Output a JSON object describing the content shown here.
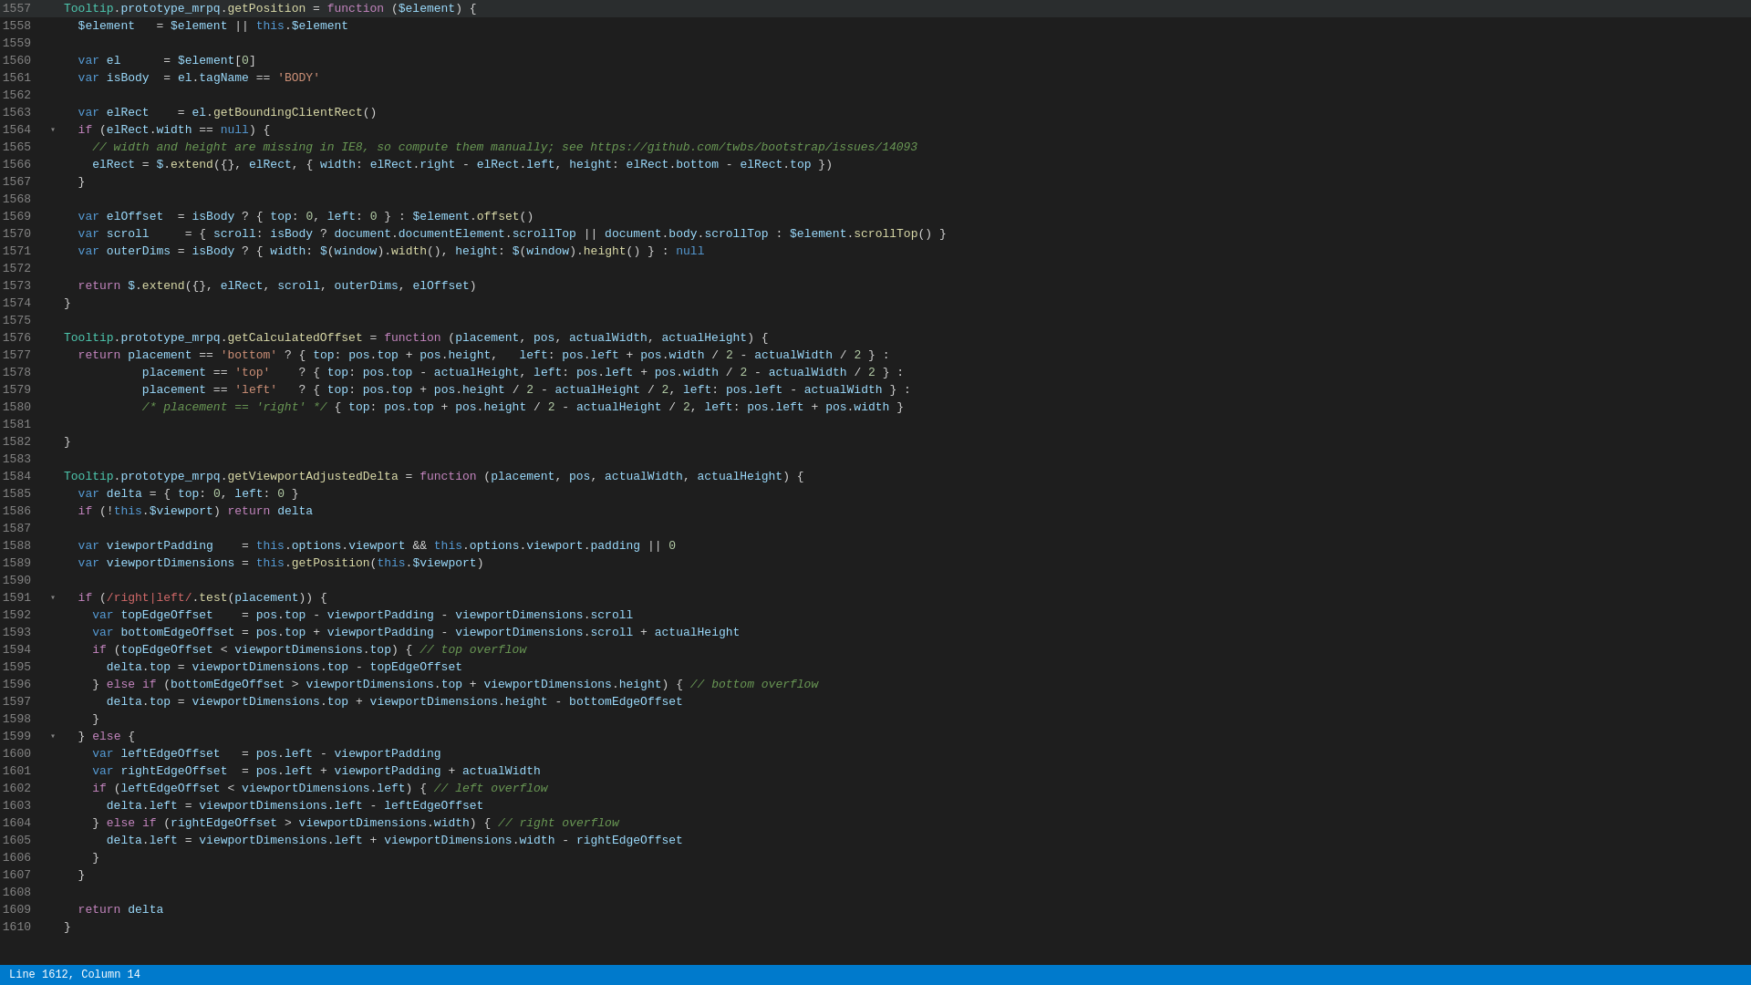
{
  "status_bar": {
    "line_col": "Line 1612, Column 14"
  },
  "lines": [
    {
      "num": 1557,
      "fold": "",
      "content": "<span class='cls'>Tooltip</span><span class='op'>.</span><span class='prop'>prototype_mrpq</span><span class='op'>.</span><span class='fn'>getPosition</span> <span class='op'>=</span> <span class='kw'>function</span> <span class='punc'>(</span><span class='param'>$element</span><span class='punc'>) {</span>"
    },
    {
      "num": 1558,
      "fold": "",
      "content": "  <span class='param'>$element</span>   <span class='op'>=</span> <span class='param'>$element</span> <span class='op'>||</span> <span class='this'>this</span><span class='op'>.</span><span class='prop'>$element</span>"
    },
    {
      "num": 1559,
      "fold": "",
      "content": ""
    },
    {
      "num": 1560,
      "fold": "",
      "content": "  <span class='kw2'>var</span> <span class='prop'>el</span>      <span class='op'>=</span> <span class='param'>$element</span><span class='punc'>[</span><span class='num'>0</span><span class='punc'>]</span>"
    },
    {
      "num": 1561,
      "fold": "",
      "content": "  <span class='kw2'>var</span> <span class='prop'>isBody</span>  <span class='op'>=</span> <span class='prop'>el</span><span class='op'>.</span><span class='prop'>tagName</span> <span class='op'>==</span> <span class='str'>'BODY'</span>"
    },
    {
      "num": 1562,
      "fold": "",
      "content": ""
    },
    {
      "num": 1563,
      "fold": "",
      "content": "  <span class='kw2'>var</span> <span class='prop'>elRect</span>    <span class='op'>=</span> <span class='prop'>el</span><span class='op'>.</span><span class='fn'>getBoundingClientRect</span><span class='punc'>()</span>"
    },
    {
      "num": 1564,
      "fold": "open",
      "content": "  <span class='kw'>if</span> <span class='punc'>(</span><span class='prop'>elRect</span><span class='op'>.</span><span class='prop'>width</span> <span class='op'>==</span> <span class='bool'>null</span><span class='punc'>) {</span>"
    },
    {
      "num": 1565,
      "fold": "",
      "content": "    <span class='cmt'>// width and height are missing in IE8, so compute them manually; see https://github.com/twbs/bootstrap/issues/14093</span>"
    },
    {
      "num": 1566,
      "fold": "",
      "content": "    <span class='prop'>elRect</span> <span class='op'>=</span> <span class='prop'>$</span><span class='op'>.</span><span class='fn'>extend</span><span class='punc'>(</span><span class='punc'>{},</span> <span class='prop'>elRect</span><span class='punc'>,</span> <span class='punc'>{ </span><span class='prop'>width</span><span class='op'>:</span> <span class='prop'>elRect</span><span class='op'>.</span><span class='prop'>right</span> <span class='op'>-</span> <span class='prop'>elRect</span><span class='op'>.</span><span class='prop'>left</span><span class='punc'>,</span> <span class='prop'>height</span><span class='op'>:</span> <span class='prop'>elRect</span><span class='op'>.</span><span class='prop'>bottom</span> <span class='op'>-</span> <span class='prop'>elRect</span><span class='op'>.</span><span class='prop'>top</span> <span class='punc'>})</span>"
    },
    {
      "num": 1567,
      "fold": "",
      "content": "  <span class='punc'>}</span>"
    },
    {
      "num": 1568,
      "fold": "",
      "content": ""
    },
    {
      "num": 1569,
      "fold": "",
      "content": "  <span class='kw2'>var</span> <span class='prop'>elOffset</span>  <span class='op'>=</span> <span class='prop'>isBody</span> <span class='op'>?</span> <span class='punc'>{ </span><span class='prop'>top</span><span class='op'>:</span> <span class='num'>0</span><span class='punc'>,</span> <span class='prop'>left</span><span class='op'>:</span> <span class='num'>0</span> <span class='punc'>}</span> <span class='op'>:</span> <span class='param'>$element</span><span class='op'>.</span><span class='fn'>offset</span><span class='punc'>()</span>"
    },
    {
      "num": 1570,
      "fold": "",
      "content": "  <span class='kw2'>var</span> <span class='prop'>scroll</span>     <span class='op'>=</span> <span class='punc'>{ </span><span class='prop'>scroll</span><span class='op'>:</span> <span class='prop'>isBody</span> <span class='op'>?</span> <span class='prop'>document</span><span class='op'>.</span><span class='prop'>documentElement</span><span class='op'>.</span><span class='prop'>scrollTop</span> <span class='op'>||</span> <span class='prop'>document</span><span class='op'>.</span><span class='prop'>body</span><span class='op'>.</span><span class='prop'>scrollTop</span> <span class='op'>:</span> <span class='param'>$element</span><span class='op'>.</span><span class='fn'>scrollTop</span><span class='punc'>() }</span>"
    },
    {
      "num": 1571,
      "fold": "",
      "content": "  <span class='kw2'>var</span> <span class='prop'>outerDims</span> <span class='op'>=</span> <span class='prop'>isBody</span> <span class='op'>?</span> <span class='punc'>{ </span><span class='prop'>width</span><span class='op'>:</span> <span class='prop'>$</span><span class='punc'>(</span><span class='prop'>window</span><span class='punc'>)</span><span class='op'>.</span><span class='fn'>width</span><span class='punc'>(),</span> <span class='prop'>height</span><span class='op'>:</span> <span class='prop'>$</span><span class='punc'>(</span><span class='prop'>window</span><span class='punc'>)</span><span class='op'>.</span><span class='fn'>height</span><span class='punc'>() }</span> <span class='op'>:</span> <span class='bool'>null</span>"
    },
    {
      "num": 1572,
      "fold": "",
      "content": ""
    },
    {
      "num": 1573,
      "fold": "",
      "content": "  <span class='kw'>return</span> <span class='prop'>$</span><span class='op'>.</span><span class='fn'>extend</span><span class='punc'>(</span><span class='punc'>{},</span> <span class='prop'>elRect</span><span class='punc'>,</span> <span class='prop'>scroll</span><span class='punc'>,</span> <span class='prop'>outerDims</span><span class='punc'>,</span> <span class='prop'>elOffset</span><span class='punc'>)</span>"
    },
    {
      "num": 1574,
      "fold": "",
      "content": "<span class='punc'>}</span>"
    },
    {
      "num": 1575,
      "fold": "",
      "content": ""
    },
    {
      "num": 1576,
      "fold": "",
      "content": "<span class='cls'>Tooltip</span><span class='op'>.</span><span class='prop'>prototype_mrpq</span><span class='op'>.</span><span class='fn'>getCalculatedOffset</span> <span class='op'>=</span> <span class='kw'>function</span> <span class='punc'>(</span><span class='param'>placement</span><span class='punc'>,</span> <span class='param'>pos</span><span class='punc'>,</span> <span class='param'>actualWidth</span><span class='punc'>,</span> <span class='param'>actualHeight</span><span class='punc'>) {</span>"
    },
    {
      "num": 1577,
      "fold": "",
      "content": "  <span class='kw'>return</span> <span class='param'>placement</span> <span class='op'>==</span> <span class='str'>'bottom'</span> <span class='op'>?</span> <span class='punc'>{ </span><span class='prop'>top</span><span class='op'>:</span> <span class='param'>pos</span><span class='op'>.</span><span class='prop'>top</span> <span class='op'>+</span> <span class='param'>pos</span><span class='op'>.</span><span class='prop'>height</span><span class='punc'>,</span>   <span class='prop'>left</span><span class='op'>:</span> <span class='param'>pos</span><span class='op'>.</span><span class='prop'>left</span> <span class='op'>+</span> <span class='param'>pos</span><span class='op'>.</span><span class='prop'>width</span> <span class='op'>/</span> <span class='num'>2</span> <span class='op'>-</span> <span class='param'>actualWidth</span> <span class='op'>/</span> <span class='num'>2</span> <span class='punc'>}</span> <span class='op'>:</span>"
    },
    {
      "num": 1578,
      "fold": "",
      "content": "           <span class='param'>placement</span> <span class='op'>==</span> <span class='str'>'top'</span>    <span class='op'>?</span> <span class='punc'>{ </span><span class='prop'>top</span><span class='op'>:</span> <span class='param'>pos</span><span class='op'>.</span><span class='prop'>top</span> <span class='op'>-</span> <span class='param'>actualHeight</span><span class='punc'>,</span> <span class='prop'>left</span><span class='op'>:</span> <span class='param'>pos</span><span class='op'>.</span><span class='prop'>left</span> <span class='op'>+</span> <span class='param'>pos</span><span class='op'>.</span><span class='prop'>width</span> <span class='op'>/</span> <span class='num'>2</span> <span class='op'>-</span> <span class='param'>actualWidth</span> <span class='op'>/</span> <span class='num'>2</span> <span class='punc'>}</span> <span class='op'>:</span>"
    },
    {
      "num": 1579,
      "fold": "",
      "content": "           <span class='param'>placement</span> <span class='op'>==</span> <span class='str'>'left'</span>   <span class='op'>?</span> <span class='punc'>{ </span><span class='prop'>top</span><span class='op'>:</span> <span class='param'>pos</span><span class='op'>.</span><span class='prop'>top</span> <span class='op'>+</span> <span class='param'>pos</span><span class='op'>.</span><span class='prop'>height</span> <span class='op'>/</span> <span class='num'>2</span> <span class='op'>-</span> <span class='param'>actualHeight</span> <span class='op'>/</span> <span class='num'>2</span><span class='punc'>,</span> <span class='prop'>left</span><span class='op'>:</span> <span class='param'>pos</span><span class='op'>.</span><span class='prop'>left</span> <span class='op'>-</span> <span class='param'>actualWidth</span> <span class='punc'>}</span> <span class='op'>:</span>"
    },
    {
      "num": 1580,
      "fold": "",
      "content": "           <span class='cmt'>/* placement == 'right' */</span> <span class='punc'>{ </span><span class='prop'>top</span><span class='op'>:</span> <span class='param'>pos</span><span class='op'>.</span><span class='prop'>top</span> <span class='op'>+</span> <span class='param'>pos</span><span class='op'>.</span><span class='prop'>height</span> <span class='op'>/</span> <span class='num'>2</span> <span class='op'>-</span> <span class='param'>actualHeight</span> <span class='op'>/</span> <span class='num'>2</span><span class='punc'>,</span> <span class='prop'>left</span><span class='op'>:</span> <span class='param'>pos</span><span class='op'>.</span><span class='prop'>left</span> <span class='op'>+</span> <span class='param'>pos</span><span class='op'>.</span><span class='prop'>width</span> <span class='punc'>}</span>"
    },
    {
      "num": 1581,
      "fold": "",
      "content": ""
    },
    {
      "num": 1582,
      "fold": "",
      "content": "<span class='punc'>}</span>"
    },
    {
      "num": 1583,
      "fold": "",
      "content": ""
    },
    {
      "num": 1584,
      "fold": "",
      "content": "<span class='cls'>Tooltip</span><span class='op'>.</span><span class='prop'>prototype_mrpq</span><span class='op'>.</span><span class='fn'>getViewportAdjustedDelta</span> <span class='op'>=</span> <span class='kw'>function</span> <span class='punc'>(</span><span class='param'>placement</span><span class='punc'>,</span> <span class='param'>pos</span><span class='punc'>,</span> <span class='param'>actualWidth</span><span class='punc'>,</span> <span class='param'>actualHeight</span><span class='punc'>) {</span>"
    },
    {
      "num": 1585,
      "fold": "",
      "content": "  <span class='kw2'>var</span> <span class='prop'>delta</span> <span class='op'>=</span> <span class='punc'>{ </span><span class='prop'>top</span><span class='op'>:</span> <span class='num'>0</span><span class='punc'>,</span> <span class='prop'>left</span><span class='op'>:</span> <span class='num'>0</span> <span class='punc'>}</span>"
    },
    {
      "num": 1586,
      "fold": "",
      "content": "  <span class='kw'>if</span> <span class='punc'>(!</span><span class='this'>this</span><span class='op'>.</span><span class='prop'>$viewport</span><span class='punc'>)</span> <span class='kw'>return</span> <span class='prop'>delta</span>"
    },
    {
      "num": 1587,
      "fold": "",
      "content": ""
    },
    {
      "num": 1588,
      "fold": "",
      "content": "  <span class='kw2'>var</span> <span class='prop'>viewportPadding</span>    <span class='op'>=</span> <span class='this'>this</span><span class='op'>.</span><span class='prop'>options</span><span class='op'>.</span><span class='prop'>viewport</span> <span class='op'>&amp;&amp;</span> <span class='this'>this</span><span class='op'>.</span><span class='prop'>options</span><span class='op'>.</span><span class='prop'>viewport</span><span class='op'>.</span><span class='prop'>padding</span> <span class='op'>||</span> <span class='num'>0</span>"
    },
    {
      "num": 1589,
      "fold": "",
      "content": "  <span class='kw2'>var</span> <span class='prop'>viewportDimensions</span> <span class='op'>=</span> <span class='this'>this</span><span class='op'>.</span><span class='fn'>getPosition</span><span class='punc'>(</span><span class='this'>this</span><span class='op'>.</span><span class='prop'>$viewport</span><span class='punc'>)</span>"
    },
    {
      "num": 1590,
      "fold": "",
      "content": ""
    },
    {
      "num": 1591,
      "fold": "open",
      "content": "  <span class='kw'>if</span> <span class='punc'>(</span><span class='reg'>/right|left/</span><span class='op'>.</span><span class='fn'>test</span><span class='punc'>(</span><span class='param'>placement</span><span class='punc'>)) {</span>"
    },
    {
      "num": 1592,
      "fold": "",
      "content": "    <span class='kw2'>var</span> <span class='prop'>topEdgeOffset</span>    <span class='op'>=</span> <span class='param'>pos</span><span class='op'>.</span><span class='prop'>top</span> <span class='op'>-</span> <span class='prop'>viewportPadding</span> <span class='op'>-</span> <span class='prop'>viewportDimensions</span><span class='op'>.</span><span class='prop'>scroll</span>"
    },
    {
      "num": 1593,
      "fold": "",
      "content": "    <span class='kw2'>var</span> <span class='prop'>bottomEdgeOffset</span> <span class='op'>=</span> <span class='param'>pos</span><span class='op'>.</span><span class='prop'>top</span> <span class='op'>+</span> <span class='prop'>viewportPadding</span> <span class='op'>-</span> <span class='prop'>viewportDimensions</span><span class='op'>.</span><span class='prop'>scroll</span> <span class='op'>+</span> <span class='param'>actualHeight</span>"
    },
    {
      "num": 1594,
      "fold": "",
      "content": "    <span class='kw'>if</span> <span class='punc'>(</span><span class='prop'>topEdgeOffset</span> <span class='op'>&lt;</span> <span class='prop'>viewportDimensions</span><span class='op'>.</span><span class='prop'>top</span><span class='punc'>)</span> <span class='punc'>{ </span><span class='cmt'>// top overflow</span>"
    },
    {
      "num": 1595,
      "fold": "",
      "content": "      <span class='prop'>delta</span><span class='op'>.</span><span class='prop'>top</span> <span class='op'>=</span> <span class='prop'>viewportDimensions</span><span class='op'>.</span><span class='prop'>top</span> <span class='op'>-</span> <span class='prop'>topEdgeOffset</span>"
    },
    {
      "num": 1596,
      "fold": "",
      "content": "    <span class='punc'>}</span> <span class='kw'>else</span> <span class='kw'>if</span> <span class='punc'>(</span><span class='prop'>bottomEdgeOffset</span> <span class='op'>&gt;</span> <span class='prop'>viewportDimensions</span><span class='op'>.</span><span class='prop'>top</span> <span class='op'>+</span> <span class='prop'>viewportDimensions</span><span class='op'>.</span><span class='prop'>height</span><span class='punc'>)</span> <span class='punc'>{ </span><span class='cmt'>// bottom overflow</span>"
    },
    {
      "num": 1597,
      "fold": "",
      "content": "      <span class='prop'>delta</span><span class='op'>.</span><span class='prop'>top</span> <span class='op'>=</span> <span class='prop'>viewportDimensions</span><span class='op'>.</span><span class='prop'>top</span> <span class='op'>+</span> <span class='prop'>viewportDimensions</span><span class='op'>.</span><span class='prop'>height</span> <span class='op'>-</span> <span class='prop'>bottomEdgeOffset</span>"
    },
    {
      "num": 1598,
      "fold": "",
      "content": "    <span class='punc'>}</span>"
    },
    {
      "num": 1599,
      "fold": "open",
      "content": "  <span class='punc'>}</span> <span class='kw'>else</span> <span class='punc'>{</span>"
    },
    {
      "num": 1600,
      "fold": "",
      "content": "    <span class='kw2'>var</span> <span class='prop'>leftEdgeOffset</span>   <span class='op'>=</span> <span class='param'>pos</span><span class='op'>.</span><span class='prop'>left</span> <span class='op'>-</span> <span class='prop'>viewportPadding</span>"
    },
    {
      "num": 1601,
      "fold": "",
      "content": "    <span class='kw2'>var</span> <span class='prop'>rightEdgeOffset</span>  <span class='op'>=</span> <span class='param'>pos</span><span class='op'>.</span><span class='prop'>left</span> <span class='op'>+</span> <span class='prop'>viewportPadding</span> <span class='op'>+</span> <span class='param'>actualWidth</span>"
    },
    {
      "num": 1602,
      "fold": "",
      "content": "    <span class='kw'>if</span> <span class='punc'>(</span><span class='prop'>leftEdgeOffset</span> <span class='op'>&lt;</span> <span class='prop'>viewportDimensions</span><span class='op'>.</span><span class='prop'>left</span><span class='punc'>)</span> <span class='punc'>{ </span><span class='cmt'>// left overflow</span>"
    },
    {
      "num": 1603,
      "fold": "",
      "content": "      <span class='prop'>delta</span><span class='op'>.</span><span class='prop'>left</span> <span class='op'>=</span> <span class='prop'>viewportDimensions</span><span class='op'>.</span><span class='prop'>left</span> <span class='op'>-</span> <span class='prop'>leftEdgeOffset</span>"
    },
    {
      "num": 1604,
      "fold": "",
      "content": "    <span class='punc'>}</span> <span class='kw'>else</span> <span class='kw'>if</span> <span class='punc'>(</span><span class='prop'>rightEdgeOffset</span> <span class='op'>&gt;</span> <span class='prop'>viewportDimensions</span><span class='op'>.</span><span class='prop'>width</span><span class='punc'>)</span> <span class='punc'>{ </span><span class='cmt'>// right overflow</span>"
    },
    {
      "num": 1605,
      "fold": "",
      "content": "      <span class='prop'>delta</span><span class='op'>.</span><span class='prop'>left</span> <span class='op'>=</span> <span class='prop'>viewportDimensions</span><span class='op'>.</span><span class='prop'>left</span> <span class='op'>+</span> <span class='prop'>viewportDimensions</span><span class='op'>.</span><span class='prop'>width</span> <span class='op'>-</span> <span class='prop'>rightEdgeOffset</span>"
    },
    {
      "num": 1606,
      "fold": "",
      "content": "    <span class='punc'>}</span>"
    },
    {
      "num": 1607,
      "fold": "",
      "content": "  <span class='punc'>}</span>"
    },
    {
      "num": 1608,
      "fold": "",
      "content": ""
    },
    {
      "num": 1609,
      "fold": "",
      "content": "  <span class='kw'>return</span> <span class='prop'>delta</span>"
    },
    {
      "num": 1610,
      "fold": "",
      "content": "<span class='punc'>}</span>"
    }
  ]
}
